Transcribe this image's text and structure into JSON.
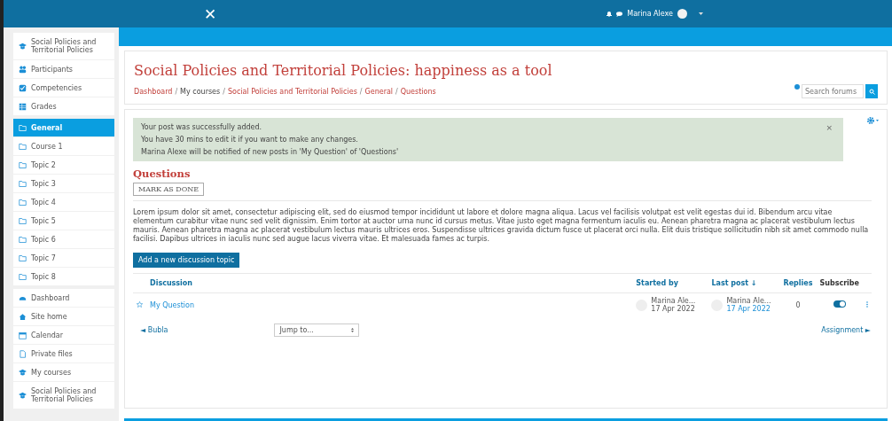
{
  "navbar": {
    "close": "✕",
    "user_name": "Marina Alexe"
  },
  "sidebar": {
    "groups": [
      {
        "items": [
          {
            "label": "Social Policies and Territorial Policies",
            "kind": "course",
            "selected": false
          },
          {
            "label": "Participants",
            "kind": "users",
            "selected": false
          },
          {
            "label": "Competencies",
            "kind": "check",
            "selected": false
          },
          {
            "label": "Grades",
            "kind": "grid",
            "selected": false
          }
        ]
      },
      {
        "items": [
          {
            "label": "General",
            "kind": "folder",
            "selected": true
          },
          {
            "label": "Course 1",
            "kind": "folder",
            "selected": false
          },
          {
            "label": "Topic 2",
            "kind": "folder",
            "selected": false
          },
          {
            "label": "Topic 3",
            "kind": "folder",
            "selected": false
          },
          {
            "label": "Topic 4",
            "kind": "folder",
            "selected": false
          },
          {
            "label": "Topic 5",
            "kind": "folder",
            "selected": false
          },
          {
            "label": "Topic 6",
            "kind": "folder",
            "selected": false
          },
          {
            "label": "Topic 7",
            "kind": "folder",
            "selected": false
          },
          {
            "label": "Topic 8",
            "kind": "folder",
            "selected": false
          }
        ]
      },
      {
        "items": [
          {
            "label": "Dashboard",
            "kind": "dashboard",
            "selected": false
          },
          {
            "label": "Site home",
            "kind": "home",
            "selected": false
          },
          {
            "label": "Calendar",
            "kind": "calendar",
            "selected": false
          },
          {
            "label": "Private files",
            "kind": "file",
            "selected": false
          },
          {
            "label": "My courses",
            "kind": "course",
            "selected": false
          },
          {
            "label": "Social Policies and Territorial Policies",
            "kind": "course",
            "selected": false
          }
        ]
      }
    ]
  },
  "page_header": {
    "title": "Social Policies and Territorial Policies: happiness as a tool",
    "breadcrumb": [
      {
        "label": "Dashboard",
        "link": true
      },
      {
        "separator": "/",
        "label": "My courses",
        "link": false
      },
      {
        "separator": "/",
        "label": "Social Policies and Territorial Policies",
        "link": true
      },
      {
        "separator": "/",
        "label": "General",
        "link": true
      },
      {
        "separator": "/",
        "label": "Questions",
        "link": true
      }
    ],
    "search": {
      "placeholder": "Search forums"
    }
  },
  "alert": {
    "lines": [
      "Your post was successfully added.",
      "You have 30 mins to edit it if you want to make any changes.",
      "Marina Alexe will be notified of new posts in 'My Question' of 'Questions'"
    ],
    "close": "×"
  },
  "forum": {
    "title": "Questions",
    "mark_done": "MARK AS DONE",
    "description": "Lorem ipsum dolor sit amet, consectetur adipiscing elit, sed do eiusmod tempor incididunt ut labore et dolore magna aliqua. Lacus vel facilisis volutpat est velit egestas dui id. Bibendum arcu vitae elementum curabitur vitae nunc sed velit dignissim. Enim tortor at auctor urna nunc id cursus metus. Vitae justo eget magna fermentum iaculis eu. Aenean pharetra magna ac placerat vestibulum lectus mauris. Aenean pharetra magna ac placerat vestibulum lectus mauris ultrices eros. Suspendisse ultrices gravida dictum fusce ut placerat orci nulla. Elit duis tristique sollicitudin nibh sit amet commodo nulla facilisi. Dapibus ultrices in iaculis nunc sed augue lacus viverra vitae. Et malesuada fames ac turpis.",
    "add_button": "Add a new discussion topic"
  },
  "table": {
    "columns": [
      "Discussion",
      "Started by",
      "Last post ↓",
      "Replies",
      "Subscribe"
    ],
    "rows": [
      {
        "starred": false,
        "discussion": "My Question",
        "started_by": "Marina Ale...",
        "started_date": "17 Apr 2022",
        "last_post_by": "Marina Ale...",
        "last_post_date": "17 Apr 2022",
        "replies": "0",
        "subscribed": true
      }
    ]
  },
  "nav": {
    "previous": "◄ Bubla",
    "jump": "Jump to...",
    "next": "Assignment ►"
  }
}
